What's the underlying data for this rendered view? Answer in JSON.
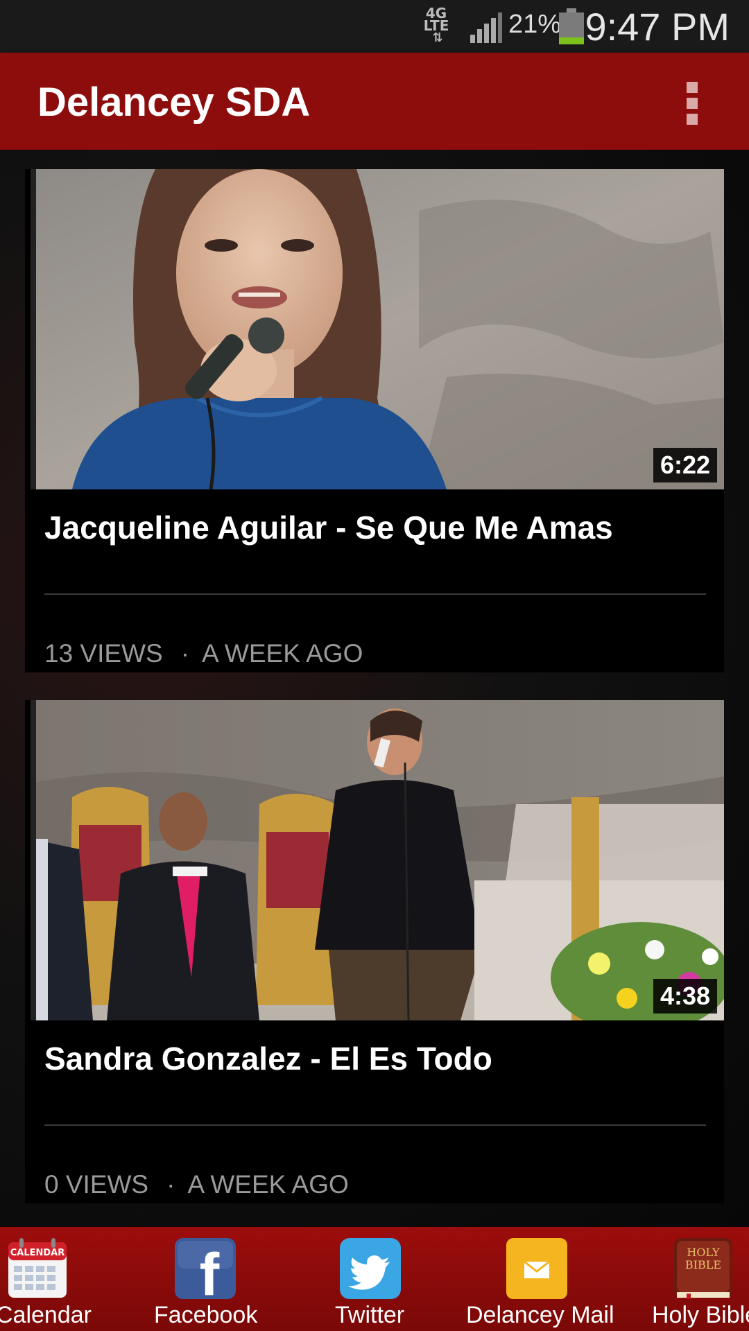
{
  "status_bar": {
    "network": "4G",
    "network_sub": "LTE",
    "battery_percent": "21%",
    "battery_level": 0.21,
    "time": "9:47 PM"
  },
  "app_bar": {
    "title": "Delancey SDA",
    "menu_icon": "overflow-menu-icon"
  },
  "videos": [
    {
      "title": "Jacqueline Aguilar - Se Que Me Amas",
      "duration": "6:22",
      "views": "13 VIEWS",
      "separator": "·",
      "age": "A WEEK AGO"
    },
    {
      "title": "Sandra Gonzalez - El Es Todo",
      "duration": "4:38",
      "views": "0 VIEWS",
      "separator": "·",
      "age": "A WEEK AGO"
    }
  ],
  "bottom_nav": {
    "items": [
      {
        "label": "Calendar",
        "icon": "calendar-icon",
        "icon_text": "CALENDAR"
      },
      {
        "label": "Facebook",
        "icon": "facebook-icon",
        "icon_text": "f"
      },
      {
        "label": "Twitter",
        "icon": "twitter-icon"
      },
      {
        "label": "Delancey Mail",
        "icon": "mail-icon"
      },
      {
        "label": "Holy Bible",
        "icon": "bible-icon",
        "icon_text": "HOLY BIBLE"
      }
    ]
  },
  "colors": {
    "primary": "#8d0d0c",
    "status_bar": "#1a1a1a",
    "battery_fill": "#7cc21a",
    "meta_text": "#9a9a9a"
  }
}
